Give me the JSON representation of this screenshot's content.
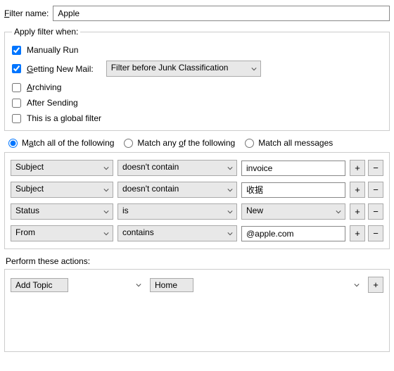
{
  "labels": {
    "filter_name": "Filter name:",
    "apply_legend": "Apply filter when:",
    "manual": "Manually Run",
    "getting": "Getting New Mail:",
    "archiving": "Archiving",
    "after_sending": "After Sending",
    "global": "This is a global filter",
    "match_all": "Match all of the following",
    "match_any": "Match any of the following",
    "match_allmsg": "Match all messages",
    "perform": "Perform these actions:",
    "plus": "+",
    "minus": "−"
  },
  "filter_name": "Apple",
  "junk_timing": "Filter before Junk Classification",
  "checks": {
    "manual": true,
    "getting": true,
    "archiving": false,
    "after_sending": false,
    "global": false
  },
  "match_mode": "all",
  "criteria": [
    {
      "field": "Subject",
      "op": "doesn't contain",
      "type": "text",
      "value": "invoice"
    },
    {
      "field": "Subject",
      "op": "doesn't contain",
      "type": "text",
      "value": "收据"
    },
    {
      "field": "Status",
      "op": "is",
      "type": "select",
      "value": "New"
    },
    {
      "field": "From",
      "op": "contains",
      "type": "text",
      "value": "@apple.com"
    }
  ],
  "actions": [
    {
      "action": "Add Topic",
      "value": "Home"
    }
  ]
}
